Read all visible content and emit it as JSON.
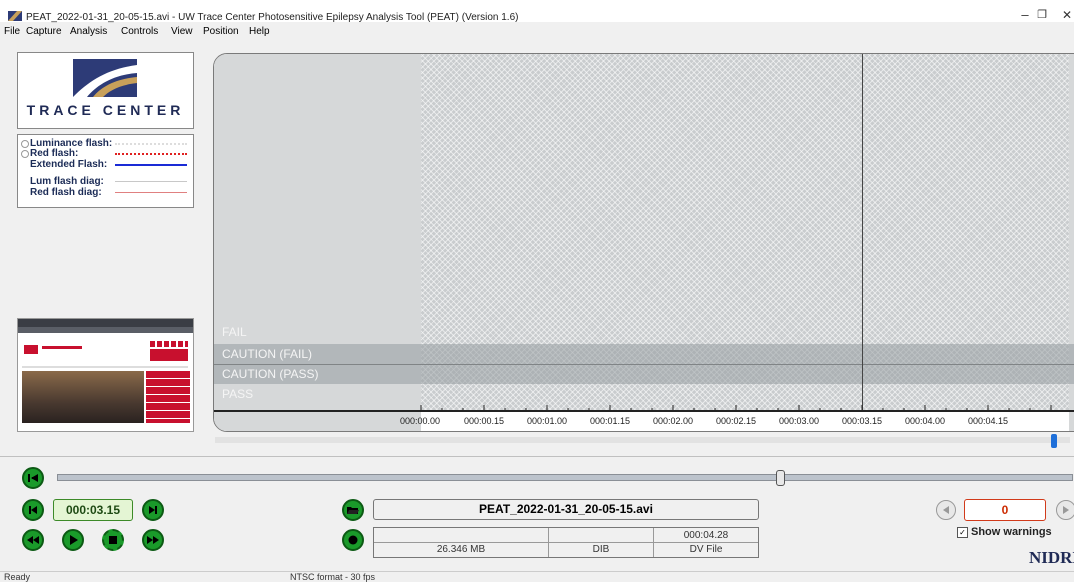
{
  "window": {
    "title": "PEAT_2022-01-31_20-05-15.avi - UW Trace Center Photosensitive Epilepsy Analysis Tool (PEAT) (Version 1.6)",
    "minimize": "–",
    "maximize": "❐",
    "close": "✕"
  },
  "menu": [
    "File",
    "Capture",
    "Analysis",
    "Controls",
    "View",
    "Position",
    "Help"
  ],
  "logo": {
    "text": "TRACE CENTER"
  },
  "legend": {
    "items": [
      {
        "label": "Luminance flash:",
        "color": "#ffffff"
      },
      {
        "label": "Red flash:",
        "color": "#e02020"
      },
      {
        "label": "Extended Flash:",
        "color": "#1a2bd6"
      },
      {
        "label": "Lum flash diag:",
        "color": "#c8c8c8"
      },
      {
        "label": "Red flash diag:",
        "color": "#e08080"
      }
    ]
  },
  "graph": {
    "zones": {
      "fail": "FAIL",
      "caution_fail": "CAUTION (FAIL)",
      "caution_pass": "CAUTION (PASS)",
      "pass": "PASS"
    },
    "ticks": [
      "000:00.00",
      "000:00.15",
      "000:01.00",
      "000:01.15",
      "000:02.00",
      "000:02.15",
      "000:03.00",
      "000:03.15",
      "000:04.00",
      "000:04.15"
    ]
  },
  "controls": {
    "current_time": "000:03.15",
    "file_name": "PEAT_2022-01-31_20-05-15.avi",
    "duration": "000:04.28",
    "file_size": "26.346 MB",
    "format": "DIB",
    "source": "DV File",
    "warning_count": "0",
    "show_warnings_label": "Show warnings",
    "show_warnings_checked": true,
    "sponsor": "NIDRR"
  },
  "status": {
    "left": "Ready",
    "middle": "NTSC format - 30 fps"
  },
  "colors": {
    "button_green": "#1a9a2a",
    "warning_red": "#cc2a00",
    "time_bg": "#e4f5d4"
  }
}
